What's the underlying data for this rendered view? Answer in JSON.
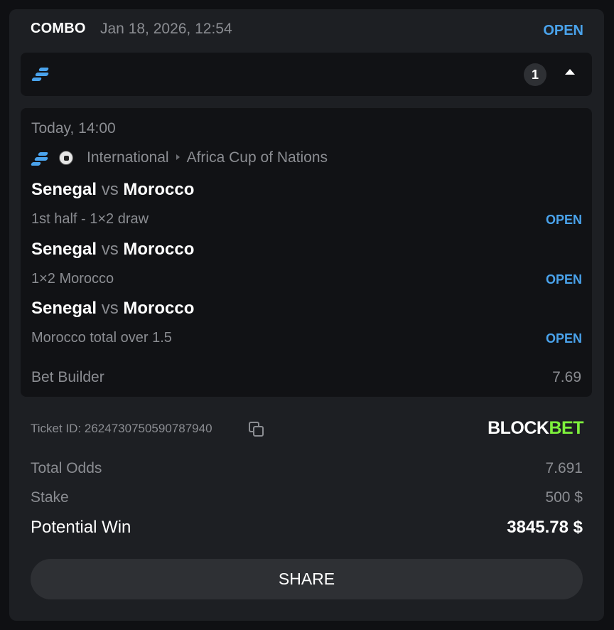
{
  "header": {
    "bet_type": "COMBO",
    "date": "Jan 18, 2026, 12:54",
    "status": "OPEN"
  },
  "summary": {
    "sport_icon": "stacked-bars-logo-icon",
    "leg_count": "1",
    "toggle_icon": "caret-up-icon"
  },
  "event": {
    "time": "Today, 14:00",
    "sport_icon": "soccer-ball-icon",
    "category": "International",
    "competition": "Africa Cup of Nations"
  },
  "legs": [
    {
      "home": "Senegal",
      "vs": "vs",
      "away": "Morocco",
      "market": "1st half - 1×2 draw",
      "status": "OPEN"
    },
    {
      "home": "Senegal",
      "vs": "vs",
      "away": "Morocco",
      "market": "1×2 Morocco",
      "status": "OPEN"
    },
    {
      "home": "Senegal",
      "vs": "vs",
      "away": "Morocco",
      "market": "Morocco total over 1.5",
      "status": "OPEN"
    }
  ],
  "bet_builder": {
    "label": "Bet Builder",
    "odds": "7.69"
  },
  "ticket": {
    "label": "Ticket ID:",
    "id": "2624730750590787940",
    "copy_icon": "copy-icon"
  },
  "brand": {
    "part1": "BLOCK",
    "part2": "BET",
    "accent": "#7ef13c"
  },
  "totals": {
    "total_odds_label": "Total Odds",
    "total_odds": "7.691",
    "stake_label": "Stake",
    "stake": "500 $",
    "potential_win_label": "Potential Win",
    "potential_win": "3845.78 $"
  },
  "share_label": "SHARE",
  "colors": {
    "accent": "#4aa3ec",
    "background": "#1d1f23",
    "panel": "#111215"
  }
}
